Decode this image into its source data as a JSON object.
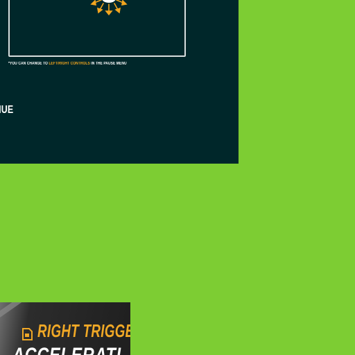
{
  "colors": {
    "background": "#7dcd33",
    "panel": "#00272a",
    "accent": "#f2a51f",
    "text": "#ffffff"
  },
  "controls_hint": {
    "icon": "controller-tilt-icon",
    "prefix": "*YOU CAN CHANGE TO ",
    "highlight": "LEFT/RIGHT CONTROLS",
    "suffix": " IN THE PAUSE MENU"
  },
  "continue_label": "NTINUE",
  "promo": {
    "icon": "trigger-badge-icon",
    "title": "RIGHT TRIGGE",
    "subtitle": "ACCELERATI"
  }
}
